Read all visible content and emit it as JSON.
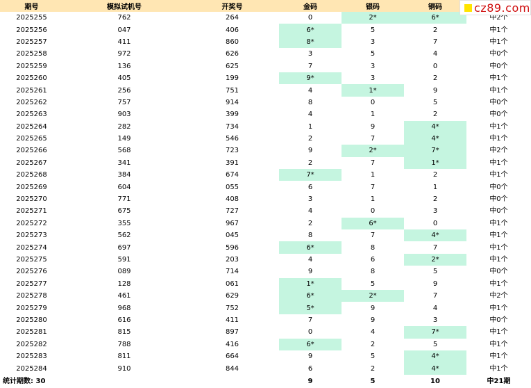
{
  "headers": [
    "期号",
    "模拟试机号",
    "开奖号",
    "金码",
    "银码",
    "铜码",
    ""
  ],
  "colors": {
    "header_bg": "#ffe6b3",
    "hit_bg": "#c5f5e0",
    "logo_red": "#d01010"
  },
  "logo": {
    "text": "cz89.com",
    "icon": "yellow-square-icon"
  },
  "rows": [
    {
      "period": "2025255",
      "sim": "762",
      "draw": "264",
      "gold": "0",
      "silver": "2*",
      "bronze": "6*",
      "result": "中2个",
      "hit": [
        false,
        true,
        true
      ]
    },
    {
      "period": "2025256",
      "sim": "047",
      "draw": "406",
      "gold": "6*",
      "silver": "5",
      "bronze": "2",
      "result": "中1个",
      "hit": [
        true,
        false,
        false
      ]
    },
    {
      "period": "2025257",
      "sim": "411",
      "draw": "860",
      "gold": "8*",
      "silver": "3",
      "bronze": "7",
      "result": "中1个",
      "hit": [
        true,
        false,
        false
      ]
    },
    {
      "period": "2025258",
      "sim": "972",
      "draw": "626",
      "gold": "3",
      "silver": "5",
      "bronze": "4",
      "result": "中0个",
      "hit": [
        false,
        false,
        false
      ]
    },
    {
      "period": "2025259",
      "sim": "136",
      "draw": "625",
      "gold": "7",
      "silver": "3",
      "bronze": "0",
      "result": "中0个",
      "hit": [
        false,
        false,
        false
      ]
    },
    {
      "period": "2025260",
      "sim": "405",
      "draw": "199",
      "gold": "9*",
      "silver": "3",
      "bronze": "2",
      "result": "中1个",
      "hit": [
        true,
        false,
        false
      ]
    },
    {
      "period": "2025261",
      "sim": "256",
      "draw": "751",
      "gold": "4",
      "silver": "1*",
      "bronze": "9",
      "result": "中1个",
      "hit": [
        false,
        true,
        false
      ]
    },
    {
      "period": "2025262",
      "sim": "757",
      "draw": "914",
      "gold": "8",
      "silver": "0",
      "bronze": "5",
      "result": "中0个",
      "hit": [
        false,
        false,
        false
      ]
    },
    {
      "period": "2025263",
      "sim": "903",
      "draw": "399",
      "gold": "4",
      "silver": "1",
      "bronze": "2",
      "result": "中0个",
      "hit": [
        false,
        false,
        false
      ]
    },
    {
      "period": "2025264",
      "sim": "282",
      "draw": "734",
      "gold": "1",
      "silver": "9",
      "bronze": "4*",
      "result": "中1个",
      "hit": [
        false,
        false,
        true
      ]
    },
    {
      "period": "2025265",
      "sim": "149",
      "draw": "546",
      "gold": "2",
      "silver": "7",
      "bronze": "4*",
      "result": "中1个",
      "hit": [
        false,
        false,
        true
      ]
    },
    {
      "period": "2025266",
      "sim": "568",
      "draw": "723",
      "gold": "9",
      "silver": "2*",
      "bronze": "7*",
      "result": "中2个",
      "hit": [
        false,
        true,
        true
      ]
    },
    {
      "period": "2025267",
      "sim": "341",
      "draw": "391",
      "gold": "2",
      "silver": "7",
      "bronze": "1*",
      "result": "中1个",
      "hit": [
        false,
        false,
        true
      ]
    },
    {
      "period": "2025268",
      "sim": "384",
      "draw": "674",
      "gold": "7*",
      "silver": "1",
      "bronze": "2",
      "result": "中1个",
      "hit": [
        true,
        false,
        false
      ]
    },
    {
      "period": "2025269",
      "sim": "604",
      "draw": "055",
      "gold": "6",
      "silver": "7",
      "bronze": "1",
      "result": "中0个",
      "hit": [
        false,
        false,
        false
      ]
    },
    {
      "period": "2025270",
      "sim": "771",
      "draw": "408",
      "gold": "3",
      "silver": "1",
      "bronze": "2",
      "result": "中0个",
      "hit": [
        false,
        false,
        false
      ]
    },
    {
      "period": "2025271",
      "sim": "675",
      "draw": "727",
      "gold": "4",
      "silver": "0",
      "bronze": "3",
      "result": "中0个",
      "hit": [
        false,
        false,
        false
      ]
    },
    {
      "period": "2025272",
      "sim": "355",
      "draw": "967",
      "gold": "2",
      "silver": "6*",
      "bronze": "0",
      "result": "中1个",
      "hit": [
        false,
        true,
        false
      ]
    },
    {
      "period": "2025273",
      "sim": "562",
      "draw": "045",
      "gold": "8",
      "silver": "7",
      "bronze": "4*",
      "result": "中1个",
      "hit": [
        false,
        false,
        true
      ]
    },
    {
      "period": "2025274",
      "sim": "697",
      "draw": "596",
      "gold": "6*",
      "silver": "8",
      "bronze": "7",
      "result": "中1个",
      "hit": [
        true,
        false,
        false
      ]
    },
    {
      "period": "2025275",
      "sim": "591",
      "draw": "203",
      "gold": "4",
      "silver": "6",
      "bronze": "2*",
      "result": "中1个",
      "hit": [
        false,
        false,
        true
      ]
    },
    {
      "period": "2025276",
      "sim": "089",
      "draw": "714",
      "gold": "9",
      "silver": "8",
      "bronze": "5",
      "result": "中0个",
      "hit": [
        false,
        false,
        false
      ]
    },
    {
      "period": "2025277",
      "sim": "128",
      "draw": "061",
      "gold": "1*",
      "silver": "5",
      "bronze": "9",
      "result": "中1个",
      "hit": [
        true,
        false,
        false
      ]
    },
    {
      "period": "2025278",
      "sim": "461",
      "draw": "629",
      "gold": "6*",
      "silver": "2*",
      "bronze": "7",
      "result": "中2个",
      "hit": [
        true,
        true,
        false
      ]
    },
    {
      "period": "2025279",
      "sim": "968",
      "draw": "752",
      "gold": "5*",
      "silver": "9",
      "bronze": "4",
      "result": "中1个",
      "hit": [
        true,
        false,
        false
      ]
    },
    {
      "period": "2025280",
      "sim": "616",
      "draw": "411",
      "gold": "7",
      "silver": "9",
      "bronze": "3",
      "result": "中0个",
      "hit": [
        false,
        false,
        false
      ]
    },
    {
      "period": "2025281",
      "sim": "815",
      "draw": "897",
      "gold": "0",
      "silver": "4",
      "bronze": "7*",
      "result": "中1个",
      "hit": [
        false,
        false,
        true
      ]
    },
    {
      "period": "2025282",
      "sim": "788",
      "draw": "416",
      "gold": "6*",
      "silver": "2",
      "bronze": "5",
      "result": "中1个",
      "hit": [
        true,
        false,
        false
      ]
    },
    {
      "period": "2025283",
      "sim": "811",
      "draw": "664",
      "gold": "9",
      "silver": "5",
      "bronze": "4*",
      "result": "中1个",
      "hit": [
        false,
        false,
        true
      ]
    },
    {
      "period": "2025284",
      "sim": "910",
      "draw": "844",
      "gold": "6",
      "silver": "2",
      "bronze": "4*",
      "result": "中1个",
      "hit": [
        false,
        false,
        true
      ]
    }
  ],
  "footer": {
    "label": "统计期数: 30",
    "gold": "9",
    "silver": "5",
    "bronze": "10",
    "result": "中21期"
  }
}
